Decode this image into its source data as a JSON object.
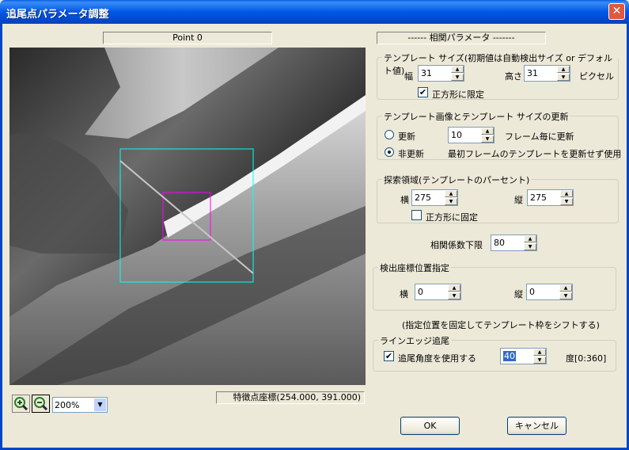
{
  "window": {
    "title": "追尾点パラメータ調整",
    "close_glyph": "✕"
  },
  "image_panel": {
    "point_label": "Point 0",
    "zoom_value": "200%",
    "coord_readout": "特徴点座標(254.000, 391.000)"
  },
  "section_header": "------ 相関パラメータ  -------",
  "template_size": {
    "legend": "テンプレート サイズ(初期値は自動検出サイズ or デフォルト値)",
    "width_label": "幅",
    "width_value": "31",
    "height_label": "高さ",
    "height_value": "31",
    "unit": "ピクセル",
    "square_label": "正方形に限定",
    "square_checked": true
  },
  "update": {
    "legend": "テンプレート画像とテンプレート サイズの更新",
    "update_label": "更新",
    "frames_value": "10",
    "frames_suffix": "フレーム毎に更新",
    "no_update_label": "非更新",
    "no_update_desc": "最初フレームのテンプレートを更新せず使用",
    "selected": "no_update"
  },
  "search": {
    "legend": "探索領域(テンプレートのパーセント)",
    "h_label": "横",
    "h_value": "275",
    "v_label": "縦",
    "v_value": "275",
    "square_label": "正方形に固定",
    "square_checked": false
  },
  "correlation": {
    "label": "相関係数下限",
    "value": "80"
  },
  "detect_pos": {
    "legend": "検出座標位置指定",
    "h_label": "横",
    "h_value": "0",
    "v_label": "縦",
    "v_value": "0",
    "note": "(指定位置を固定してテンプレート枠をシフトする)"
  },
  "line_edge": {
    "legend": "ラインエッジ追尾",
    "check_label": "追尾角度を使用する",
    "checked": true,
    "angle_value": "40",
    "range_label": "度[0:360]"
  },
  "buttons": {
    "ok": "OK",
    "cancel": "キャンセル"
  },
  "colors": {
    "title_blue": "#0058e6",
    "template_box": "#ff00ff",
    "search_box": "#00ffff"
  }
}
